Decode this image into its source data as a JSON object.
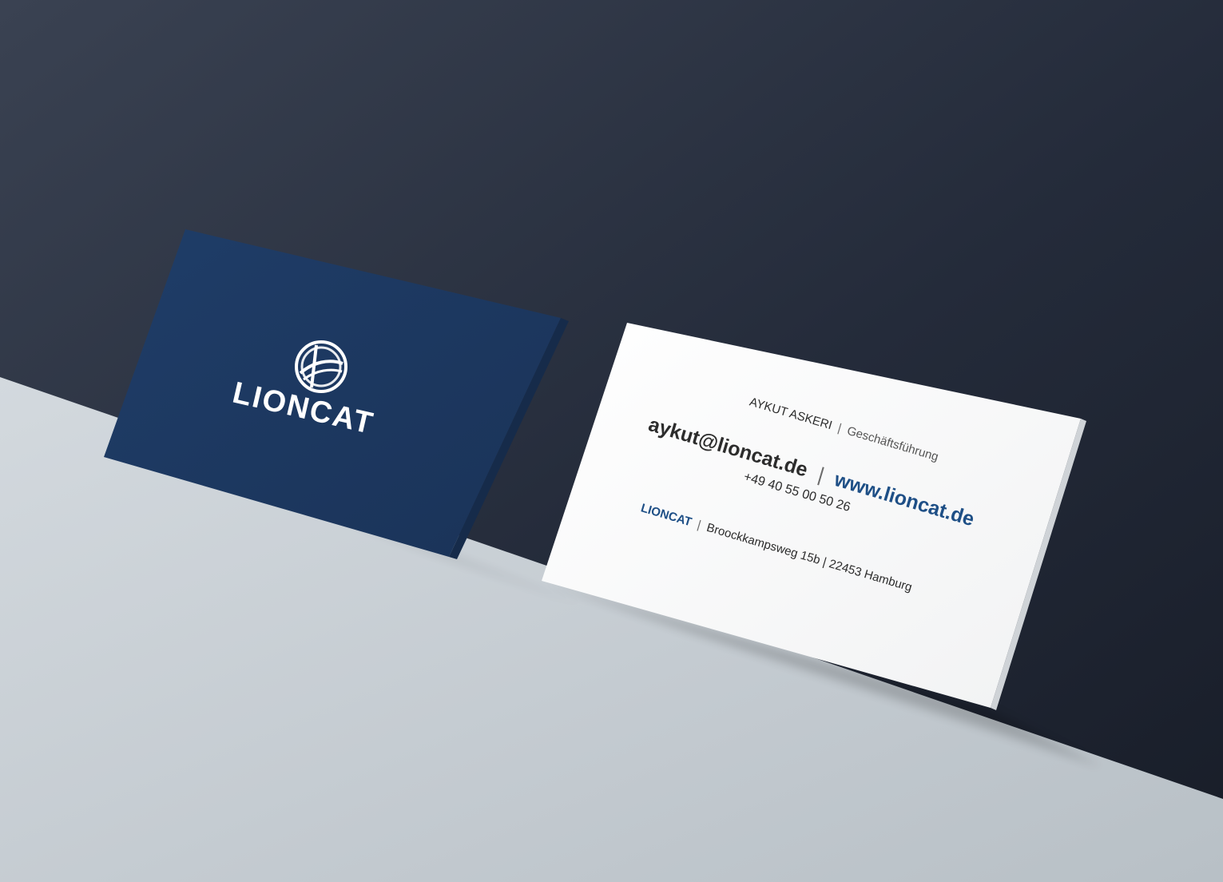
{
  "colors": {
    "wall": "#232a3a",
    "floor": "#c6cdd2",
    "front_card": "#1e3a62",
    "back_card": "#ffffff",
    "brand_blue": "#1e4f86",
    "ink": "#2c2c2c"
  },
  "front_card": {
    "logo_icon": "lioncat-emblem-icon",
    "logo_text": "LIONCAT"
  },
  "back_card": {
    "name": "AYKUT ASKERI",
    "separator": "|",
    "role": "Geschäftsführung",
    "email": "aykut@lioncat.de",
    "website": "www.lioncat.de",
    "phone": "+49 40 55 00 50 26",
    "company": "LIONCAT",
    "address": "Broockkampsweg 15b | 22453 Hamburg"
  }
}
